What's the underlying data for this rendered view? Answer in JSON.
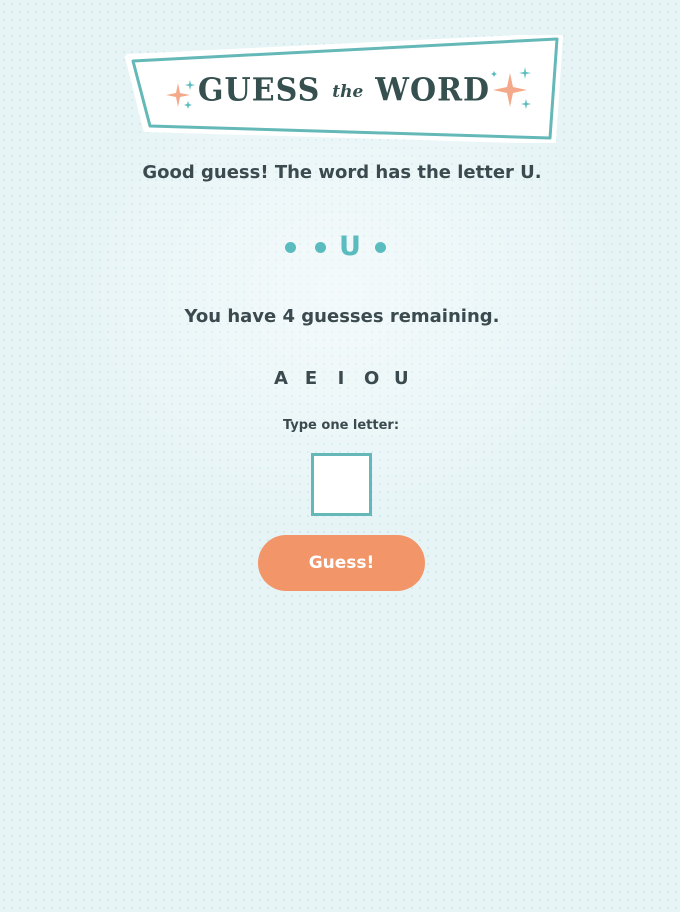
{
  "banner": {
    "word_guess": "GUESS",
    "word_the": "the",
    "word_word": "WORD"
  },
  "status_message": "Good guess! The word has the letter U.",
  "word": {
    "slots": [
      "",
      "",
      "U",
      ""
    ]
  },
  "remaining_message": "You have 4 guesses remaining.",
  "guessed_letters": [
    "A",
    "E",
    "I",
    "O",
    "U"
  ],
  "input": {
    "label": "Type one letter:",
    "value": ""
  },
  "guess_button": {
    "label": "Guess!"
  },
  "colors": {
    "background": "#e6f4f6",
    "accent_teal": "#5bbcbf",
    "button_orange": "#f29568",
    "text_dark": "#3b4a4f",
    "sparkle_peach": "#f4a98a"
  },
  "icons": {
    "banner_left": "sparkle-icon",
    "banner_right": "sparkle-icon"
  }
}
